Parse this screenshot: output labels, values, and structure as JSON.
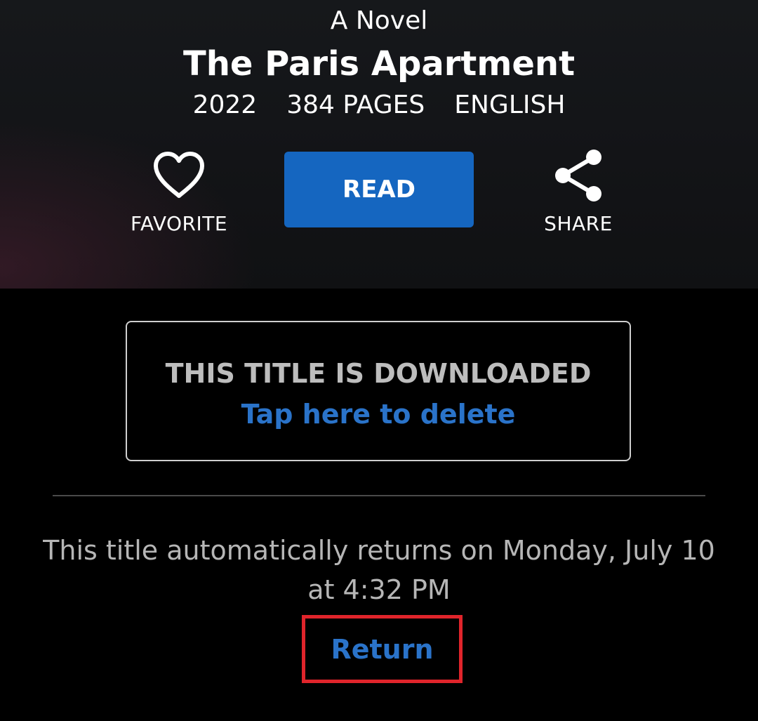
{
  "book": {
    "subtitle": "A Novel",
    "title": "The Paris Apartment",
    "meta": {
      "year": "2022",
      "pages": "384 PAGES",
      "language": "ENGLISH"
    }
  },
  "actions": {
    "favorite_label": "FAVORITE",
    "read_label": "READ",
    "share_label": "SHARE"
  },
  "download": {
    "status": "THIS TITLE IS DOWNLOADED",
    "delete_link": "Tap here to delete"
  },
  "loan": {
    "return_note": "This title automatically returns on Monday, July 10 at 4:32 PM",
    "return_label": "Return"
  },
  "icons": {
    "favorite": "heart-outline-icon",
    "share": "share-icon"
  },
  "colors": {
    "accent": "#1566c0",
    "link": "#2a73c9",
    "highlight": "#e0242b"
  }
}
